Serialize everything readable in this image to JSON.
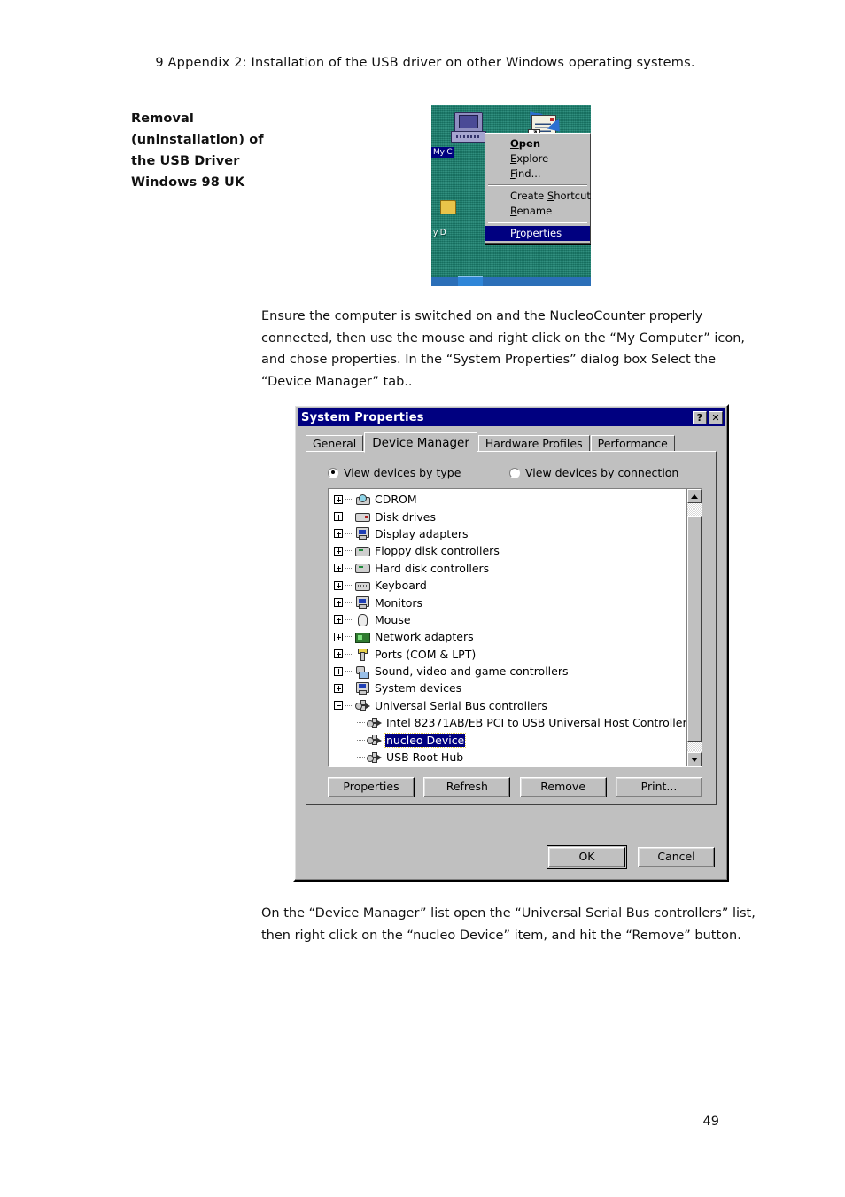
{
  "page": {
    "running_head": "9 Appendix 2: Installation of the USB driver on other Windows operating systems.",
    "number": "49",
    "margin_note": "Removal (uninstallation) of the USB Driver Windows 98 UK",
    "paragraph_1": "Ensure the computer is switched on and the NucleoCounter properly connected, then use the mouse and right click on the “My Computer” icon, and chose properties. In the “System Properties” dialog box Select the “Device Manager” tab..",
    "paragraph_2": "On the “Device Manager” list open the “Universal Serial Bus controllers” list, then right click on the “nucleo Device” item, and hit the “Remove” button."
  },
  "context_menu_figure": {
    "desktop_icon_label": "My C",
    "desktop_icon_label_2": "y D",
    "items": [
      {
        "label": "Open",
        "bold": true,
        "selected": false
      },
      {
        "label": "Explore",
        "bold": false,
        "selected": false
      },
      {
        "label": "Find...",
        "bold": false,
        "selected": false
      },
      {
        "label": "Create Shortcut",
        "bold": false,
        "selected": false
      },
      {
        "label": "Rename",
        "bold": false,
        "selected": false
      },
      {
        "label": "Properties",
        "bold": false,
        "selected": true
      }
    ],
    "colors": {
      "desktop": "#1b8270",
      "menu_face": "#c0c0c0",
      "highlight": "#000080"
    }
  },
  "dialog": {
    "title": "System Properties",
    "titlebar_buttons": [
      {
        "name": "help",
        "glyph": "?"
      },
      {
        "name": "close",
        "glyph": "✕"
      }
    ],
    "tabs": [
      {
        "label": "General",
        "active": false
      },
      {
        "label": "Device Manager",
        "active": true
      },
      {
        "label": "Hardware Profiles",
        "active": false
      },
      {
        "label": "Performance",
        "active": false
      }
    ],
    "radios": [
      {
        "label": "View devices by type",
        "selected": true
      },
      {
        "label": "View devices by connection",
        "selected": false
      }
    ],
    "tree": [
      {
        "label": "CDROM",
        "expandable": true,
        "expanded": false,
        "child": false,
        "icon": "cdrom-icon",
        "selected": false
      },
      {
        "label": "Disk drives",
        "expandable": true,
        "expanded": false,
        "child": false,
        "icon": "disk-drive-icon",
        "selected": false
      },
      {
        "label": "Display adapters",
        "expandable": true,
        "expanded": false,
        "child": false,
        "icon": "monitor-icon",
        "selected": false
      },
      {
        "label": "Floppy disk controllers",
        "expandable": true,
        "expanded": false,
        "child": false,
        "icon": "controller-icon",
        "selected": false
      },
      {
        "label": "Hard disk controllers",
        "expandable": true,
        "expanded": false,
        "child": false,
        "icon": "controller-icon",
        "selected": false
      },
      {
        "label": "Keyboard",
        "expandable": true,
        "expanded": false,
        "child": false,
        "icon": "keyboard-icon",
        "selected": false
      },
      {
        "label": "Monitors",
        "expandable": true,
        "expanded": false,
        "child": false,
        "icon": "monitor-icon",
        "selected": false
      },
      {
        "label": "Mouse",
        "expandable": true,
        "expanded": false,
        "child": false,
        "icon": "mouse-icon",
        "selected": false
      },
      {
        "label": "Network adapters",
        "expandable": true,
        "expanded": false,
        "child": false,
        "icon": "network-icon",
        "selected": false
      },
      {
        "label": "Ports (COM & LPT)",
        "expandable": true,
        "expanded": false,
        "child": false,
        "icon": "port-icon",
        "selected": false
      },
      {
        "label": "Sound, video and game controllers",
        "expandable": true,
        "expanded": false,
        "child": false,
        "icon": "sound-icon",
        "selected": false
      },
      {
        "label": "System devices",
        "expandable": true,
        "expanded": false,
        "child": false,
        "icon": "monitor-icon",
        "selected": false
      },
      {
        "label": "Universal Serial Bus controllers",
        "expandable": true,
        "expanded": true,
        "child": false,
        "icon": "usb-icon",
        "selected": false
      },
      {
        "label": "Intel 82371AB/EB PCI to USB Universal Host Controller",
        "expandable": false,
        "expanded": false,
        "child": true,
        "icon": "usb-icon",
        "selected": false
      },
      {
        "label": "nucleo Device",
        "expandable": false,
        "expanded": false,
        "child": true,
        "icon": "usb-icon",
        "selected": true
      },
      {
        "label": "USB Root Hub",
        "expandable": false,
        "expanded": false,
        "child": true,
        "icon": "usb-icon",
        "selected": false
      }
    ],
    "action_buttons": [
      {
        "label": "Properties"
      },
      {
        "label": "Refresh"
      },
      {
        "label": "Remove"
      },
      {
        "label": "Print..."
      }
    ],
    "footer_buttons": [
      {
        "label": "OK",
        "default": true
      },
      {
        "label": "Cancel",
        "default": false
      }
    ],
    "colors": {
      "face": "#c0c0c0",
      "titlebar": "#000080",
      "highlight": "#000080",
      "field": "#ffffff"
    }
  }
}
